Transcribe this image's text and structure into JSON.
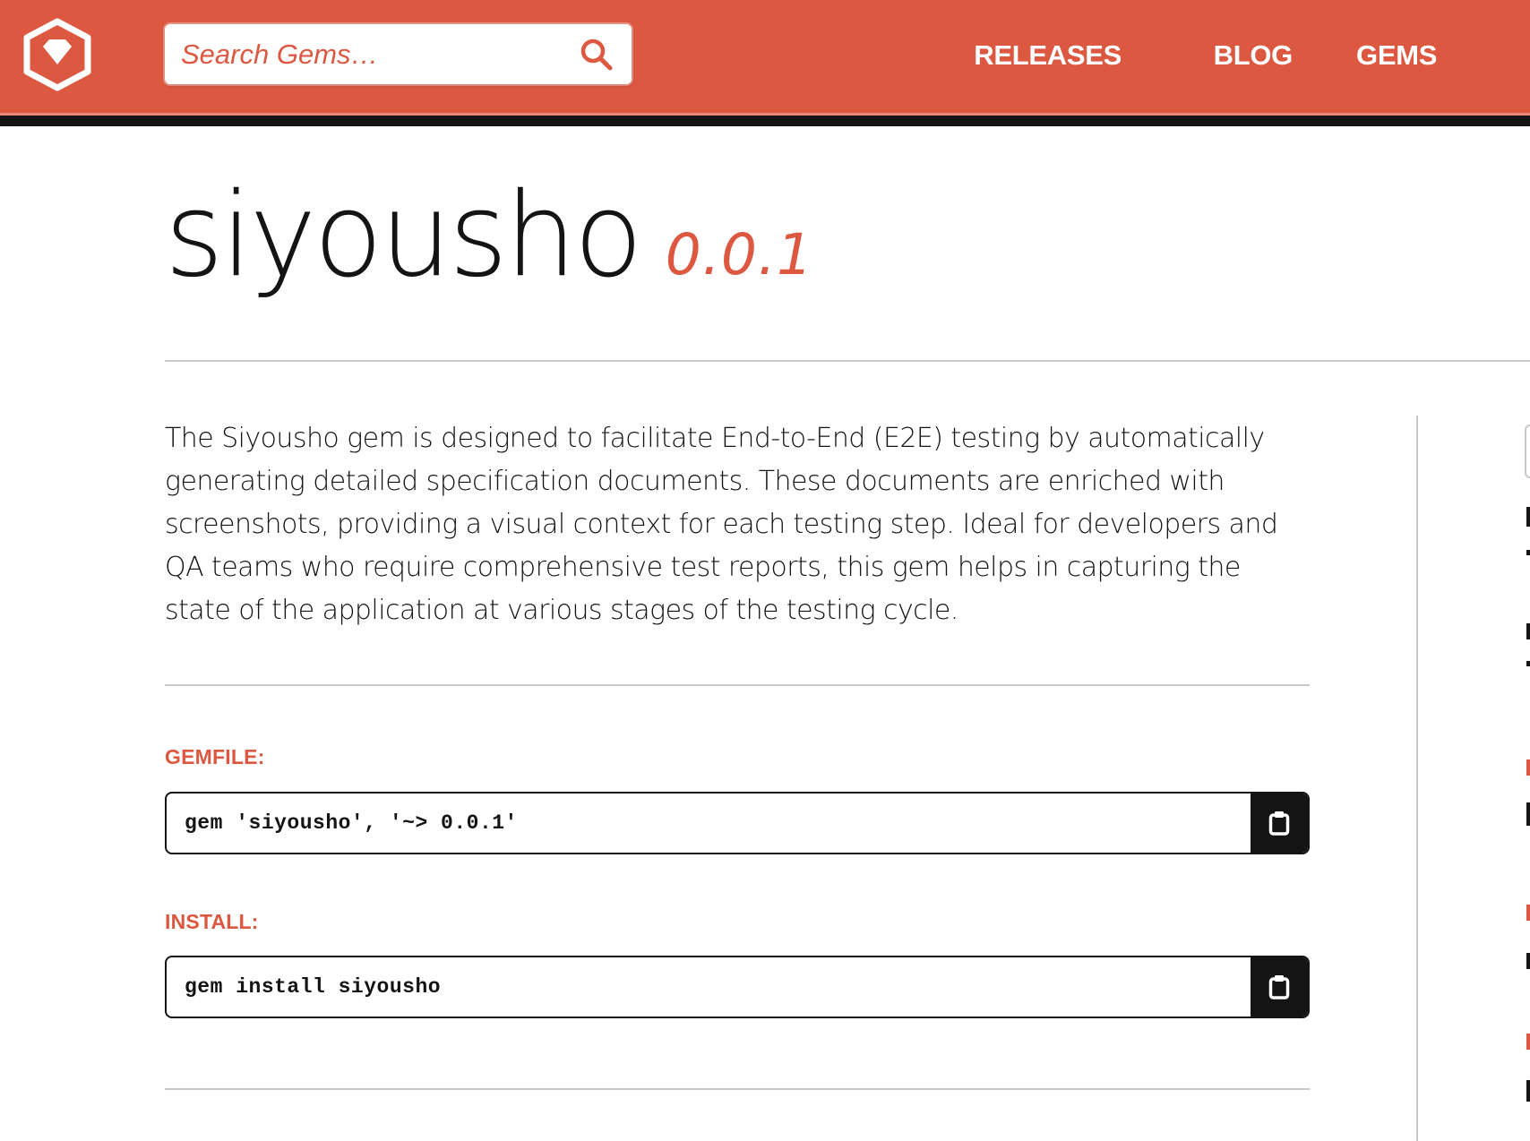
{
  "header": {
    "logo_alt": "RubyGems logo",
    "search": {
      "placeholder": "Search Gems…",
      "value": ""
    },
    "nav": [
      {
        "label": "RELEASES"
      },
      {
        "label": "BLOG"
      },
      {
        "label": "GEMS"
      }
    ]
  },
  "gem": {
    "name": "siyousho",
    "version": "0.0.1",
    "description": "The Siyousho gem is designed to facilitate End-to-End (E2E) testing by automatically generating detailed specification documents. These documents are enriched with screenshots, providing a visual context for each testing step. Ideal for developers and QA teams who require comprehensive test reports, this gem helps in capturing the state of the application at various stages of the testing cycle."
  },
  "install": {
    "gemfile_label": "GEMFILE:",
    "gemfile_code": "gem 'siyousho', '~> 0.0.1'",
    "install_label": "INSTALL:",
    "install_code": "gem install siyousho"
  },
  "icons": {
    "logo": "rubygems-gem-icon",
    "search": "search-icon",
    "copy": "clipboard-icon"
  },
  "colors": {
    "brand": "#dc5841",
    "dark": "#141414",
    "divider": "#c8c8c8"
  }
}
